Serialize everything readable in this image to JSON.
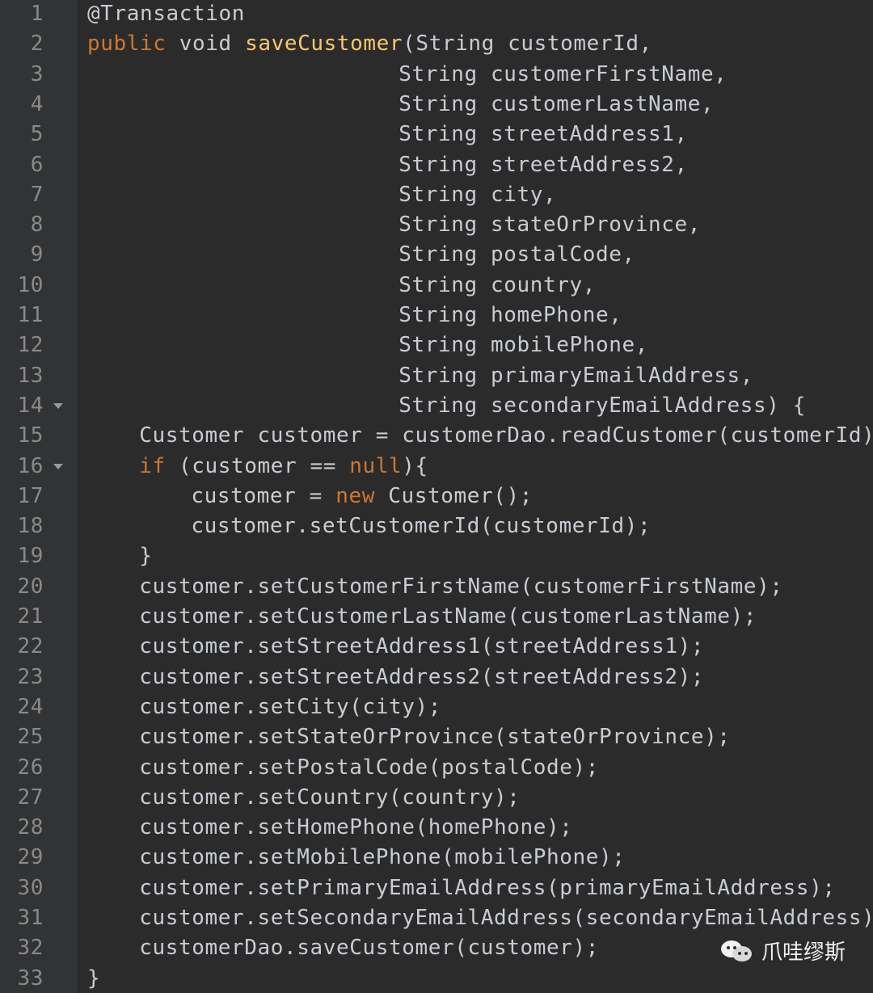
{
  "colors": {
    "background": "#2b2b2b",
    "gutter": "#313335",
    "keyword": "#cc7832",
    "function": "#ffc66d",
    "text": "#c8ccd4",
    "line_number": "#8a8a8a"
  },
  "lines": [
    {
      "n": "1",
      "indent": 0,
      "fold": false,
      "tokens": [
        {
          "t": "@Transaction",
          "c": "ann"
        }
      ]
    },
    {
      "n": "2",
      "indent": 0,
      "fold": false,
      "tokens": [
        {
          "t": "public",
          "c": "kw"
        },
        {
          "t": " void ",
          "c": "plain"
        },
        {
          "t": "saveCustomer",
          "c": "fn"
        },
        {
          "t": "(String customerId,",
          "c": "plain"
        }
      ]
    },
    {
      "n": "3",
      "indent": 24,
      "fold": false,
      "tokens": [
        {
          "t": "String customerFirstName,",
          "c": "plain"
        }
      ]
    },
    {
      "n": "4",
      "indent": 24,
      "fold": false,
      "tokens": [
        {
          "t": "String customerLastName,",
          "c": "plain"
        }
      ]
    },
    {
      "n": "5",
      "indent": 24,
      "fold": false,
      "tokens": [
        {
          "t": "String streetAddress1,",
          "c": "plain"
        }
      ]
    },
    {
      "n": "6",
      "indent": 24,
      "fold": false,
      "tokens": [
        {
          "t": "String streetAddress2,",
          "c": "plain"
        }
      ]
    },
    {
      "n": "7",
      "indent": 24,
      "fold": false,
      "tokens": [
        {
          "t": "String city,",
          "c": "plain"
        }
      ]
    },
    {
      "n": "8",
      "indent": 24,
      "fold": false,
      "tokens": [
        {
          "t": "String stateOrProvince,",
          "c": "plain"
        }
      ]
    },
    {
      "n": "9",
      "indent": 24,
      "fold": false,
      "tokens": [
        {
          "t": "String postalCode,",
          "c": "plain"
        }
      ]
    },
    {
      "n": "10",
      "indent": 24,
      "fold": false,
      "tokens": [
        {
          "t": "String country,",
          "c": "plain"
        }
      ]
    },
    {
      "n": "11",
      "indent": 24,
      "fold": false,
      "tokens": [
        {
          "t": "String homePhone,",
          "c": "plain"
        }
      ]
    },
    {
      "n": "12",
      "indent": 24,
      "fold": false,
      "tokens": [
        {
          "t": "String mobilePhone,",
          "c": "plain"
        }
      ]
    },
    {
      "n": "13",
      "indent": 24,
      "fold": false,
      "tokens": [
        {
          "t": "String primaryEmailAddress,",
          "c": "plain"
        }
      ]
    },
    {
      "n": "14",
      "indent": 24,
      "fold": true,
      "tokens": [
        {
          "t": "String secondaryEmailAddress) {",
          "c": "plain"
        }
      ]
    },
    {
      "n": "15",
      "indent": 4,
      "fold": false,
      "tokens": [
        {
          "t": "Customer customer = customerDao.readCustomer(customerId);",
          "c": "plain"
        }
      ]
    },
    {
      "n": "16",
      "indent": 4,
      "fold": true,
      "tokens": [
        {
          "t": "if",
          "c": "kw"
        },
        {
          "t": " (customer == ",
          "c": "plain"
        },
        {
          "t": "null",
          "c": "kw"
        },
        {
          "t": "){",
          "c": "plain"
        }
      ]
    },
    {
      "n": "17",
      "indent": 8,
      "fold": false,
      "tokens": [
        {
          "t": "customer = ",
          "c": "plain"
        },
        {
          "t": "new",
          "c": "kw"
        },
        {
          "t": " Customer();",
          "c": "plain"
        }
      ]
    },
    {
      "n": "18",
      "indent": 8,
      "fold": false,
      "tokens": [
        {
          "t": "customer.setCustomerId(customerId);",
          "c": "plain"
        }
      ]
    },
    {
      "n": "19",
      "indent": 4,
      "fold": false,
      "tokens": [
        {
          "t": "}",
          "c": "plain"
        }
      ]
    },
    {
      "n": "20",
      "indent": 4,
      "fold": false,
      "tokens": [
        {
          "t": "customer.setCustomerFirstName(customerFirstName);",
          "c": "plain"
        }
      ]
    },
    {
      "n": "21",
      "indent": 4,
      "fold": false,
      "tokens": [
        {
          "t": "customer.setCustomerLastName(customerLastName);",
          "c": "plain"
        }
      ]
    },
    {
      "n": "22",
      "indent": 4,
      "fold": false,
      "tokens": [
        {
          "t": "customer.setStreetAddress1(streetAddress1);",
          "c": "plain"
        }
      ]
    },
    {
      "n": "23",
      "indent": 4,
      "fold": false,
      "tokens": [
        {
          "t": "customer.setStreetAddress2(streetAddress2);",
          "c": "plain"
        }
      ]
    },
    {
      "n": "24",
      "indent": 4,
      "fold": false,
      "tokens": [
        {
          "t": "customer.setCity(city);",
          "c": "plain"
        }
      ]
    },
    {
      "n": "25",
      "indent": 4,
      "fold": false,
      "tokens": [
        {
          "t": "customer.setStateOrProvince(stateOrProvince);",
          "c": "plain"
        }
      ]
    },
    {
      "n": "26",
      "indent": 4,
      "fold": false,
      "tokens": [
        {
          "t": "customer.setPostalCode(postalCode);",
          "c": "plain"
        }
      ]
    },
    {
      "n": "27",
      "indent": 4,
      "fold": false,
      "tokens": [
        {
          "t": "customer.setCountry(country);",
          "c": "plain"
        }
      ]
    },
    {
      "n": "28",
      "indent": 4,
      "fold": false,
      "tokens": [
        {
          "t": "customer.setHomePhone(homePhone);",
          "c": "plain"
        }
      ]
    },
    {
      "n": "29",
      "indent": 4,
      "fold": false,
      "tokens": [
        {
          "t": "customer.setMobilePhone(mobilePhone);",
          "c": "plain"
        }
      ]
    },
    {
      "n": "30",
      "indent": 4,
      "fold": false,
      "tokens": [
        {
          "t": "customer.setPrimaryEmailAddress(primaryEmailAddress);",
          "c": "plain"
        }
      ]
    },
    {
      "n": "31",
      "indent": 4,
      "fold": false,
      "tokens": [
        {
          "t": "customer.setSecondaryEmailAddress(secondaryEmailAddress);",
          "c": "plain"
        }
      ]
    },
    {
      "n": "32",
      "indent": 4,
      "fold": false,
      "tokens": [
        {
          "t": "customerDao.saveCustomer(customer);",
          "c": "plain"
        }
      ]
    },
    {
      "n": "33",
      "indent": 0,
      "fold": false,
      "tokens": [
        {
          "t": "}",
          "c": "plain"
        }
      ]
    }
  ],
  "watermark": {
    "icon": "wechat-icon",
    "text": "爪哇缪斯"
  }
}
